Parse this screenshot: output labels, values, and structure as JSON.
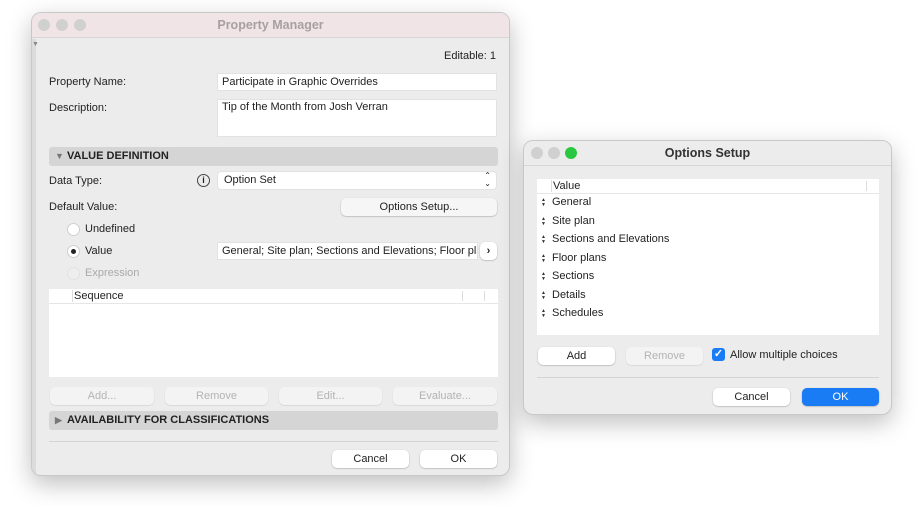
{
  "property_manager": {
    "title": "Property Manager",
    "editable": "Editable: 1",
    "property_name_label": "Property Name:",
    "property_name_value": "Participate in Graphic Overrides",
    "description_label": "Description:",
    "description_value": "Tip of the Month from Josh Verran",
    "value_definition": "VALUE DEFINITION",
    "data_type_label": "Data Type:",
    "data_type_value": "Option Set",
    "default_value_label": "Default Value:",
    "options_setup_button": "Options Setup...",
    "radio_undefined": "Undefined",
    "radio_value": "Value",
    "radio_expression": "Expression",
    "value_field": "General; Site plan; Sections and Elevations; Floor plans;",
    "sequence_header": "Sequence",
    "buttons": {
      "add": "Add...",
      "remove": "Remove",
      "edit": "Edit...",
      "evaluate": "Evaluate..."
    },
    "availability": "AVAILABILITY FOR CLASSIFICATIONS",
    "cancel": "Cancel",
    "ok": "OK"
  },
  "options_setup": {
    "title": "Options Setup",
    "column_header": "Value",
    "items": [
      "General",
      "Site plan",
      "Sections and Elevations",
      "Floor plans",
      "Sections",
      "Details",
      "Schedules"
    ],
    "add": "Add",
    "remove": "Remove",
    "allow_multiple": "Allow multiple choices",
    "allow_multiple_checked": true,
    "cancel": "Cancel",
    "ok": "OK",
    "accent": "#1a7cf5"
  }
}
